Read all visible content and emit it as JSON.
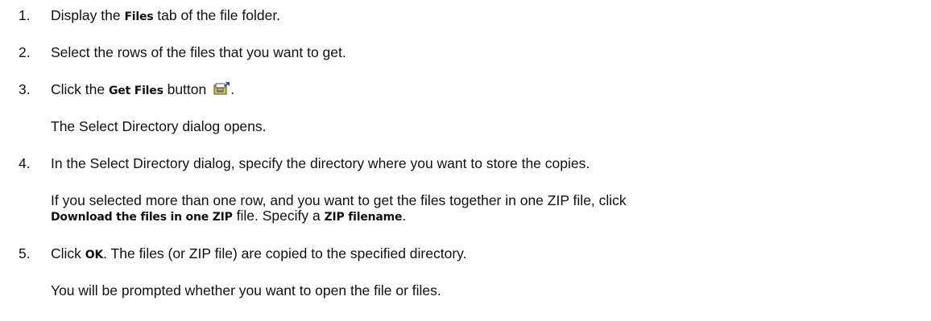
{
  "steps": [
    {
      "number": "1.",
      "pre": "Display the ",
      "ui": "Files",
      "post": " tab of the file folder."
    },
    {
      "number": "2.",
      "text": "Select the rows of the files that you want to get."
    },
    {
      "number": "3.",
      "pre": "Click the ",
      "ui": "Get Files",
      "post_before_icon": " button",
      "icon": "get-files-toolbar-icon",
      "post_after_icon": ".",
      "note": "The Select Directory dialog opens."
    },
    {
      "number": "4.",
      "text": "In the Select Directory dialog, specify the directory where you want to store the copies.",
      "para_line1": "If you selected more than one row, and you want to get the files together in one ZIP file, click",
      "para_line2_ui1": "Download the files in one ZIP",
      "para_line2_mid": " file. Specify a ",
      "para_line2_ui2": "ZIP filename",
      "para_line2_end": "."
    },
    {
      "number": "5.",
      "pre": "Click ",
      "ui": "OK",
      "post": ". The files (or ZIP file) are copied to the specified directory.",
      "note": "You will be prompted whether you want to open the file or files."
    }
  ]
}
